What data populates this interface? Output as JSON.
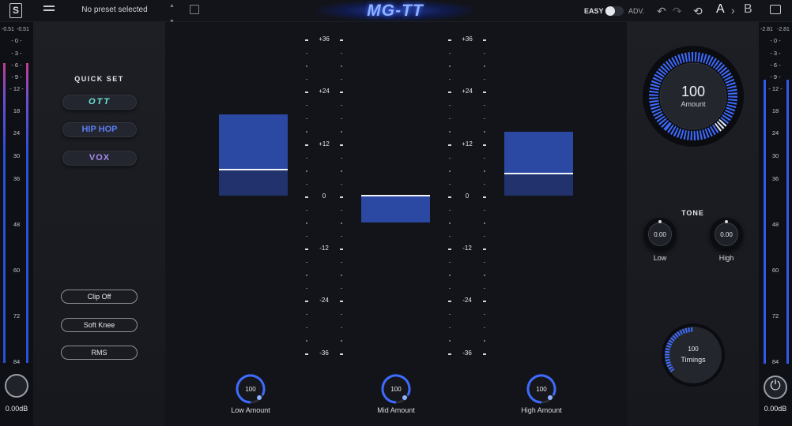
{
  "topbar": {
    "preset_name": "No preset selected",
    "brand": "MG-TT",
    "mode_easy": "EASY",
    "mode_adv": "ADV.",
    "ab_a": "A",
    "ab_b": "B"
  },
  "left_meter": {
    "peak_left": "-0.51",
    "peak_right": "-0.51",
    "scale": [
      "0",
      "3",
      "6",
      "9",
      "12",
      "18",
      "24",
      "30",
      "36",
      "48",
      "60",
      "72",
      "84"
    ],
    "output_db": "0.00dB"
  },
  "right_meter": {
    "peak_left": "-2.81",
    "peak_right": "-2.81",
    "scale": [
      "0",
      "3",
      "6",
      "9",
      "12",
      "18",
      "24",
      "30",
      "36",
      "48",
      "60",
      "72",
      "84"
    ],
    "output_db": "0.00dB"
  },
  "quick_set": {
    "title": "QUICK SET",
    "presets": [
      "OTT",
      "HIP HOP",
      "VOX"
    ]
  },
  "options": {
    "clip": "Clip Off",
    "knee": "Soft Knee",
    "detection": "RMS"
  },
  "bands": {
    "scale": [
      "+36",
      "+24",
      "+12",
      "0",
      "-12",
      "-24",
      "-36"
    ],
    "low": {
      "label": "Low Amount",
      "amount": "100"
    },
    "mid": {
      "label": "Mid Amount",
      "amount": "100"
    },
    "high": {
      "label": "High Amount",
      "amount": "100"
    }
  },
  "amount": {
    "value": "100",
    "label": "Amount"
  },
  "tone": {
    "title": "TONE",
    "low": {
      "value": "0.00",
      "label": "Low"
    },
    "high": {
      "value": "0.00",
      "label": "High"
    }
  },
  "timings": {
    "value": "100",
    "label": "Timings"
  },
  "colors": {
    "accent": "#3e6bff",
    "band_upper": "#2b48a3",
    "band_lower": "#21326c",
    "ott": "#6de4d8",
    "hiphop": "#5b7df0",
    "vox": "#a98af0"
  }
}
